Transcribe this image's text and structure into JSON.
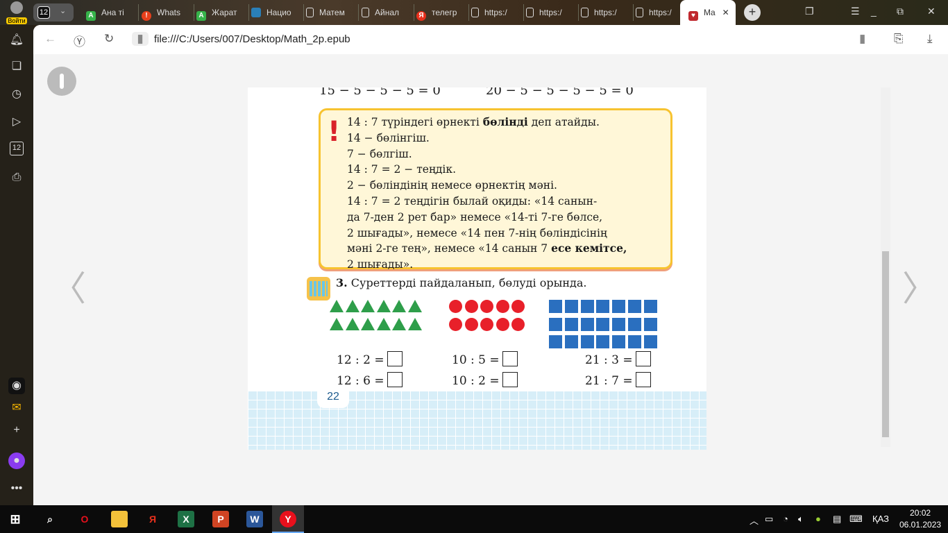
{
  "browser": {
    "login_label": "Войти",
    "tab_count": "12",
    "tabs": [
      {
        "label": "Ана ті",
        "icon": "green-a-icon",
        "color": "#36b34a"
      },
      {
        "label": "Whats",
        "icon": "alert-icon",
        "color": "#e8401c"
      },
      {
        "label": "Жарат",
        "icon": "green-a-icon",
        "color": "#36b34a"
      },
      {
        "label": "Нацио",
        "icon": "globe-icon",
        "color": "#2a7fb8"
      },
      {
        "label": "Матем",
        "icon": "document-icon",
        "color": ""
      },
      {
        "label": "Айнал",
        "icon": "document-icon",
        "color": ""
      },
      {
        "label": "телегр",
        "icon": "yandex-icon",
        "color": "#e8301c"
      },
      {
        "label": "https:/",
        "icon": "document-icon",
        "color": ""
      },
      {
        "label": "https:/",
        "icon": "document-icon",
        "color": ""
      },
      {
        "label": "https:/",
        "icon": "document-icon",
        "color": ""
      },
      {
        "label": "https:/",
        "icon": "document-icon",
        "color": ""
      }
    ],
    "active_tab": {
      "label": "Ma",
      "icon": "book-icon",
      "close": "✕"
    },
    "url": "file:///C:/Users/007/Desktop/Math_2p.epub"
  },
  "book": {
    "top_equations": [
      "15 − 5 − 5 − 5 = 0",
      "20 − 5 − 5 − 5 − 5 = 0"
    ],
    "rule_lines": [
      {
        "pre": "14 : 7 түріндегі өрнекті ",
        "bold": "бөлінді",
        "post": " деп атайды."
      },
      {
        "pre": "14 − бөлінгіш.",
        "bold": "",
        "post": ""
      },
      {
        "pre": "7 − бөлгіш.",
        "bold": "",
        "post": ""
      },
      {
        "pre": "14 : 7 = 2 − теңдік.",
        "bold": "",
        "post": ""
      },
      {
        "pre": "2 − бөліндінің немесе өрнектің мәні.",
        "bold": "",
        "post": ""
      },
      {
        "pre": "14 : 7 = 2 теңдігін былай оқиды:  «14 санын-",
        "bold": "",
        "post": ""
      },
      {
        "pre": "да 7-ден 2 рет бар» немесе «14-ті 7-ге бөлсе,",
        "bold": "",
        "post": ""
      },
      {
        "pre": "2 шығады», немесе «14 пен 7-нің бөліндісінің",
        "bold": "",
        "post": ""
      },
      {
        "pre": "мәні 2-ге тең», немесе «14 санын 7 ",
        "bold": "есе кемітсе,",
        "post": ""
      },
      {
        "pre": "2 шығады».",
        "bold": "",
        "post": ""
      }
    ],
    "task_number": "3.",
    "task_text": " Суреттерді пайдаланып, бөлуді орында.",
    "figures": {
      "triangles": 12,
      "circles": 10,
      "squares": 21
    },
    "equations": [
      [
        "12 : 2 =",
        "10 : 5 =",
        "21 : 3 ="
      ],
      [
        "12 : 6 =",
        "10 : 2 =",
        "21 : 7 ="
      ]
    ],
    "page_number": "22"
  },
  "taskbar": {
    "language": "ҚАЗ",
    "time": "20:02",
    "date": "06.01.2023"
  }
}
